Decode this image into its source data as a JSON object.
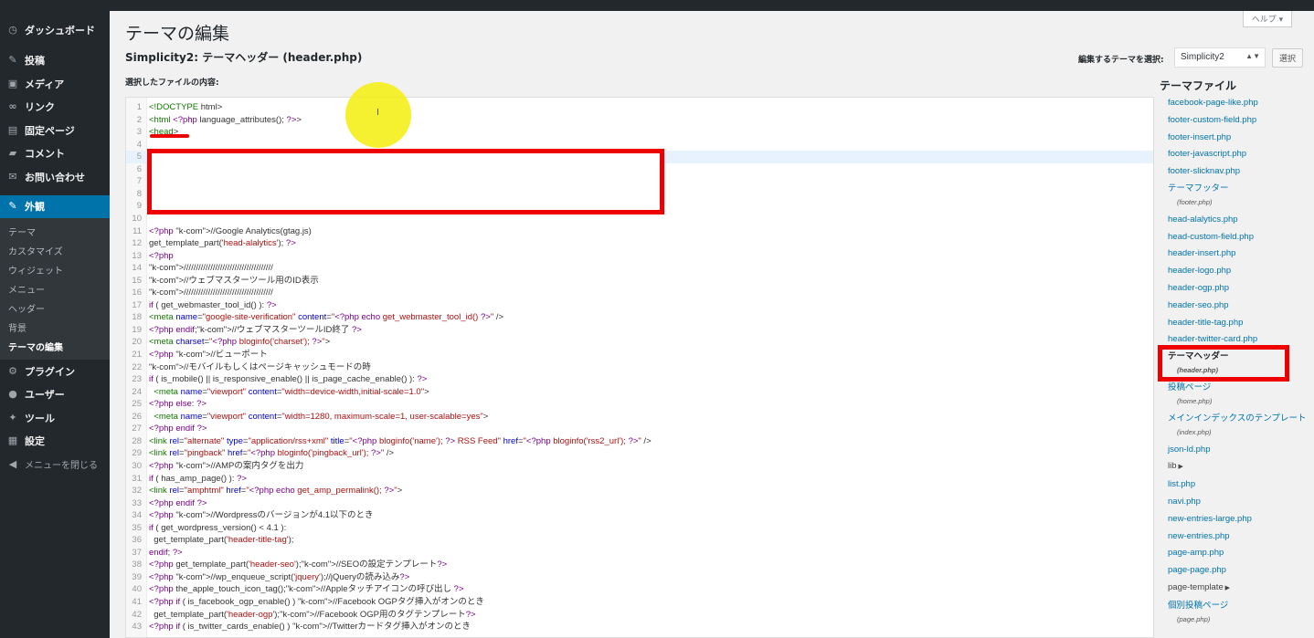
{
  "sidebar": {
    "items": [
      {
        "icon": "dashboard-icon",
        "glyph": "◷",
        "label": "ダッシュボード"
      },
      {
        "icon": "pin-icon",
        "glyph": "✎",
        "label": "投稿"
      },
      {
        "icon": "media-icon",
        "glyph": "▣",
        "label": "メディア"
      },
      {
        "icon": "link-icon",
        "glyph": "∞",
        "label": "リンク"
      },
      {
        "icon": "page-icon",
        "glyph": "▤",
        "label": "固定ページ"
      },
      {
        "icon": "comment-icon",
        "glyph": "▰",
        "label": "コメント"
      },
      {
        "icon": "mail-icon",
        "glyph": "✉",
        "label": "お問い合わせ"
      },
      {
        "icon": "appearance-icon",
        "glyph": "✎",
        "label": "外観"
      }
    ],
    "submenu": [
      "テーマ",
      "カスタマイズ",
      "ウィジェット",
      "メニュー",
      "ヘッダー",
      "背景",
      "テーマの編集"
    ],
    "items_after": [
      {
        "icon": "plugin-icon",
        "glyph": "⚙",
        "label": "プラグイン"
      },
      {
        "icon": "user-icon",
        "glyph": "●",
        "label": "ユーザー"
      },
      {
        "icon": "tool-icon",
        "glyph": "✦",
        "label": "ツール"
      },
      {
        "icon": "settings-icon",
        "glyph": "▦",
        "label": "設定"
      }
    ],
    "collapse": {
      "icon": "collapse-icon",
      "glyph": "◀",
      "label": "メニューを閉じる"
    }
  },
  "header": {
    "help": "ヘルプ ▾",
    "title": "テーマの編集",
    "file_title": "Simplicity2: テーマヘッダー (header.php)",
    "select_label": "編集するテーマを選択:",
    "select_value": "Simplicity2",
    "select_button": "選択",
    "content_label": "選択したファイルの内容:"
  },
  "editor": {
    "lines": [
      "<!DOCTYPE html>",
      "<html <?php language_attributes(); ?>>",
      "<head>",
      "",
      "",
      "",
      "",
      "",
      "",
      "",
      "<?php //Google Analytics(gtag.js)",
      "get_template_part('head-alalytics'); ?>",
      "<?php",
      "/////////////////////////////////////",
      "//ウェブマスターツール用のID表示",
      "/////////////////////////////////////",
      "if ( get_webmaster_tool_id() ): ?>",
      "<meta name=\"google-site-verification\" content=\"<?php echo get_webmaster_tool_id() ?>\" />",
      "<?php endif;//ウェブマスターツールID終了 ?>",
      "<meta charset=\"<?php bloginfo('charset'); ?>\">",
      "<?php //ビューポート",
      "//モバイルもしくはページキャッシュモードの時",
      "if ( is_mobile() || is_responsive_enable() || is_page_cache_enable() ): ?>",
      "  <meta name=\"viewport\" content=\"width=device-width,initial-scale=1.0\">",
      "<?php else: ?>",
      "  <meta name=\"viewport\" content=\"width=1280, maximum-scale=1, user-scalable=yes\">",
      "<?php endif ?>",
      "<link rel=\"alternate\" type=\"application/rss+xml\" title=\"<?php bloginfo('name'); ?> RSS Feed\" href=\"<?php bloginfo('rss2_url'); ?>\" />",
      "<link rel=\"pingback\" href=\"<?php bloginfo('pingback_url'); ?>\" />",
      "<?php //AMPの案内タグを出力",
      "if ( has_amp_page() ): ?>",
      "<link rel=\"amphtml\" href=\"<?php echo get_amp_permalink(); ?>\">",
      "<?php endif ?>",
      "<?php //Wordpressのバージョンが4.1以下のとき",
      "if ( get_wordpress_version() < 4.1 ):",
      "  get_template_part('header-title-tag');",
      "endif; ?>",
      "<?php get_template_part('header-seo');//SEOの設定テンプレート?>",
      "<?php //wp_enqueue_script('jquery');//jQueryの読み込み?>",
      "<?php the_apple_touch_icon_tag();//Appleタッチアイコンの呼び出し ?>",
      "<?php if ( is_facebook_ogp_enable() ) //Facebook OGPタグ挿入がオンのとき",
      "  get_template_part('header-ogp');//Facebook OGP用のタグテンプレート?>",
      "<?php if ( is_twitter_cards_enable() ) //Twitterカードタグ挿入がオンのとき"
    ]
  },
  "files": {
    "title": "テーマファイル",
    "items": [
      {
        "label": "facebook-page-like.php"
      },
      {
        "label": "footer-custom-field.php"
      },
      {
        "label": "footer-insert.php"
      },
      {
        "label": "footer-javascript.php"
      },
      {
        "label": "footer-slicknav.php"
      },
      {
        "label": "テーマフッター",
        "sub": "(footer.php)"
      },
      {
        "label": "head-alalytics.php"
      },
      {
        "label": "head-custom-field.php"
      },
      {
        "label": "header-insert.php"
      },
      {
        "label": "header-logo.php"
      },
      {
        "label": "header-ogp.php"
      },
      {
        "label": "header-seo.php"
      },
      {
        "label": "header-title-tag.php"
      },
      {
        "label": "header-twitter-card.php"
      },
      {
        "label": "テーマヘッダー",
        "sub": "(header.php)",
        "current": true
      },
      {
        "label": "投稿ページ",
        "sub": "(home.php)"
      },
      {
        "label": "メインインデックスのテンプレート",
        "sub": "(index.php)"
      },
      {
        "label": "json-ld.php"
      },
      {
        "label": "lib",
        "dir": true
      },
      {
        "label": "list.php"
      },
      {
        "label": "navi.php"
      },
      {
        "label": "new-entries-large.php"
      },
      {
        "label": "new-entries.php"
      },
      {
        "label": "page-amp.php"
      },
      {
        "label": "page-page.php"
      },
      {
        "label": "page-template",
        "dir": true
      },
      {
        "label": "個別投稿ページ",
        "sub": "(page.php)"
      }
    ]
  },
  "colors": {
    "accent": "#0073aa",
    "annotation_red": "#e00000",
    "highlight_yellow": "#f5f01a"
  }
}
